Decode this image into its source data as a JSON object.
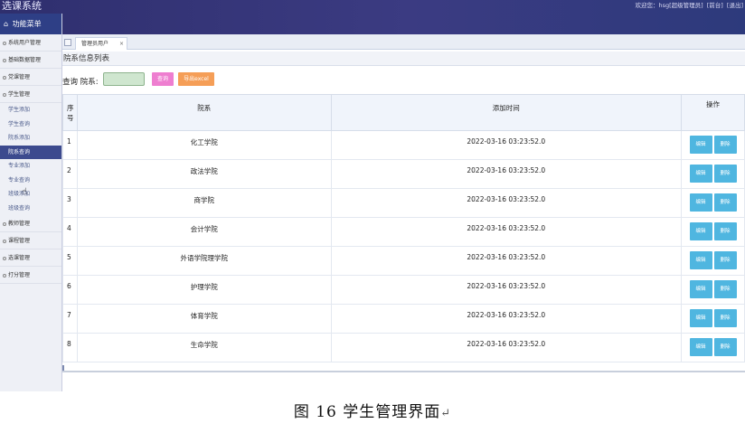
{
  "app": {
    "title": "选课系统",
    "welcome": "欢迎您：hsg[超级管理员]",
    "front_link": "[前台]",
    "logout_link": "[退出]"
  },
  "sidebar": {
    "header": "功能菜单",
    "groups_before": [
      {
        "label": "系统用户管理"
      },
      {
        "label": "基础数据管理"
      },
      {
        "label": "党课管理"
      },
      {
        "label": "学生管理"
      }
    ],
    "student_items": [
      {
        "label": "学生添加"
      },
      {
        "label": "学生查询"
      },
      {
        "label": "院系添加"
      },
      {
        "label": "院系查询",
        "active": true
      },
      {
        "label": "专业添加"
      },
      {
        "label": "专业查询"
      },
      {
        "label": "班级添加"
      },
      {
        "label": "班级查询"
      }
    ],
    "groups_after": [
      {
        "label": "教师管理"
      },
      {
        "label": "课程管理"
      },
      {
        "label": "选课管理"
      },
      {
        "label": "打分管理"
      }
    ]
  },
  "tabs": {
    "active_label": "管理员用户",
    "close_glyph": "×"
  },
  "list": {
    "title": "院系信息列表",
    "search_label": "查询 院系:",
    "search_value": "",
    "query_button": "查询",
    "export_button": "导出excel"
  },
  "table": {
    "headers": {
      "seq": "序号",
      "dept": "院系",
      "time": "添加时间",
      "ops": "操作"
    },
    "edit_label": "编辑",
    "delete_label": "删除",
    "rows": [
      {
        "seq": "1",
        "dept": "化工学院",
        "time": "2022-03-16 03:23:52.0"
      },
      {
        "seq": "2",
        "dept": "政法学院",
        "time": "2022-03-16 03:23:52.0"
      },
      {
        "seq": "3",
        "dept": "商学院",
        "time": "2022-03-16 03:23:52.0"
      },
      {
        "seq": "4",
        "dept": "会计学院",
        "time": "2022-03-16 03:23:52.0"
      },
      {
        "seq": "5",
        "dept": "外语学院理学院",
        "time": "2022-03-16 03:23:52.0"
      },
      {
        "seq": "6",
        "dept": "护理学院",
        "time": "2022-03-16 03:23:52.0"
      },
      {
        "seq": "7",
        "dept": "体育学院",
        "time": "2022-03-16 03:23:52.0"
      },
      {
        "seq": "8",
        "dept": "生命学院",
        "time": "2022-03-16 03:23:52.0"
      }
    ]
  },
  "caption": {
    "text": "图 16  学生管理界面",
    "mark": "↵"
  }
}
